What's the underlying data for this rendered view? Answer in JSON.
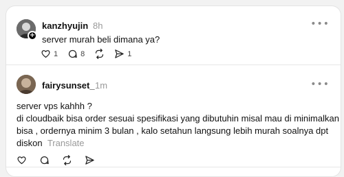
{
  "post1": {
    "username": "kanzhyujin",
    "time": "8h",
    "text": "server murah beli dimana ya?",
    "more": "•••",
    "plus": "+",
    "likes": "1",
    "replies": "8",
    "shares": "1"
  },
  "post2": {
    "username": "fairysunset_",
    "time": "1m",
    "more": "•••",
    "lines": [
      "server vps kahhh ?",
      "di cloudbaik bisa order sesuai spesifikasi yang dibutuhin misal mau di minimalkan",
      "bisa , ordernya minim 3 bulan , kalo setahun langsung lebih murah soalnya dpt",
      "diskon"
    ],
    "translate": "Translate"
  },
  "icons": {
    "like": "heart-icon",
    "reply": "comment-icon",
    "repost": "repost-icon",
    "share": "send-icon"
  }
}
